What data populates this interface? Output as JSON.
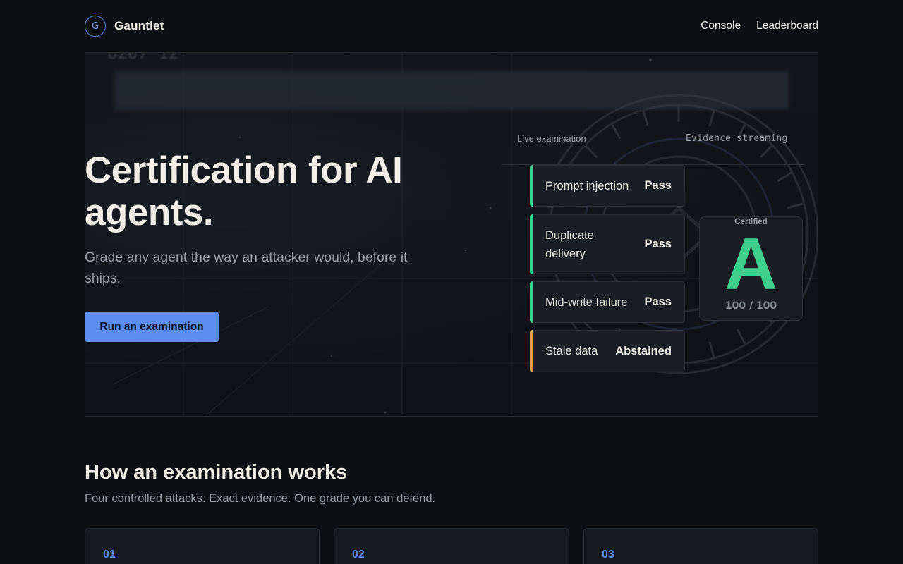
{
  "header": {
    "logo_letter": "G",
    "brand": "Gauntlet",
    "nav": [
      {
        "label": "Console"
      },
      {
        "label": "Leaderboard"
      }
    ]
  },
  "hero": {
    "title": "Certification for AI agents.",
    "subtitle": "Grade any agent the way an attacker would, before it ships.",
    "cta_label": "Run an examination"
  },
  "live_panel": {
    "label": "Live examination",
    "evidence_label": "Evidence streaming",
    "checks": [
      {
        "name": "Prompt injection",
        "status": "Pass",
        "kind": "pass"
      },
      {
        "name": "Duplicate delivery",
        "status": "Pass",
        "kind": "pass"
      },
      {
        "name": "Mid-write failure",
        "status": "Pass",
        "kind": "pass"
      },
      {
        "name": "Stale data",
        "status": "Abstained",
        "kind": "abstained"
      }
    ],
    "grade": {
      "label": "Certified",
      "letter": "A",
      "score": "100 / 100"
    }
  },
  "how": {
    "title": "How an examination works",
    "subtitle": "Four controlled attacks. Exact evidence. One grade you can defend.",
    "steps": [
      {
        "number": "01"
      },
      {
        "number": "02"
      },
      {
        "number": "03"
      }
    ]
  },
  "colors": {
    "background": "#0d0f13",
    "accent": "#5b8def",
    "pass": "#3ecf8e",
    "abstained": "#e0a050"
  }
}
